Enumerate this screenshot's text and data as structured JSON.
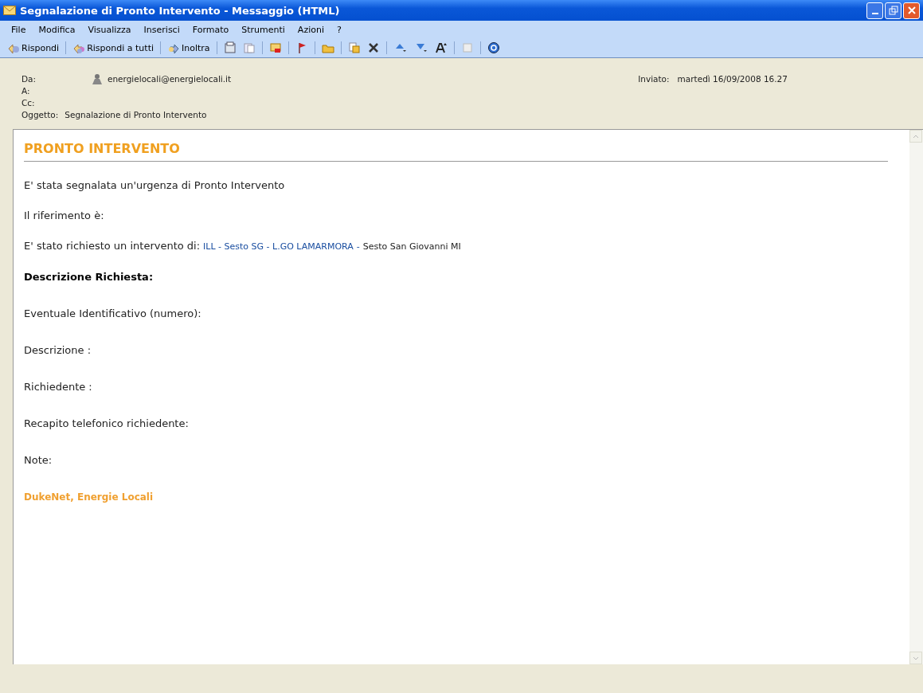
{
  "window": {
    "title": "Segnalazione di Pronto Intervento - Messaggio (HTML)"
  },
  "menu": [
    "File",
    "Modifica",
    "Visualizza",
    "Inserisci",
    "Formato",
    "Strumenti",
    "Azioni",
    "?"
  ],
  "toolbar": [
    {
      "kind": "labeled",
      "label": "Rispondi"
    },
    {
      "kind": "labeled",
      "label": "Rispondi a tutti"
    },
    {
      "kind": "labeled",
      "label": "Inoltra"
    },
    {
      "kind": "icon"
    },
    {
      "kind": "icon"
    },
    {
      "kind": "icon"
    },
    {
      "kind": "icon"
    },
    {
      "kind": "icon"
    },
    {
      "kind": "icon"
    },
    {
      "kind": "icon"
    },
    {
      "kind": "dropdown"
    },
    {
      "kind": "dropdown"
    },
    {
      "kind": "icon"
    },
    {
      "kind": "icon"
    },
    {
      "kind": "icon"
    }
  ],
  "header": {
    "fields": [
      {
        "label": "Da:",
        "value": "energielocali@energielocali.it",
        "kind": "sender"
      },
      {
        "label": "A:"
      },
      {
        "label": "Cc:"
      },
      {
        "label": "Oggetto:",
        "value": "Segnalazione di Pronto Intervento"
      }
    ],
    "sent": {
      "label": "Inviato:",
      "value": "martedì 16/09/2008 16.27"
    }
  },
  "body": {
    "heading": "PRONTO INTERVENTO",
    "paragraphs": [
      {
        "kind": "text",
        "text": "E' stata segnalata un'urgenza di Pronto Intervento"
      },
      {
        "kind": "text",
        "text": "Il riferimento è:"
      },
      {
        "kind": "request",
        "text": "E' stato richiesto un intervento di:",
        "link": "ILL - Sesto SG - L.GO LAMARMORA",
        "dash": "-",
        "place": "Sesto San Giovanni  MI"
      },
      {
        "kind": "bold",
        "text": "Descrizione Richiesta:"
      },
      {
        "kind": "field",
        "text": "Eventuale Identificativo (numero):"
      },
      {
        "kind": "field",
        "text": "Descrizione :"
      },
      {
        "kind": "field",
        "text": "Richiedente :"
      },
      {
        "kind": "field",
        "text": "Recapito telefonico richiedente:"
      },
      {
        "kind": "field",
        "text": "Note:"
      },
      {
        "kind": "signature",
        "text": "DukeNet, Energie Locali"
      }
    ]
  }
}
